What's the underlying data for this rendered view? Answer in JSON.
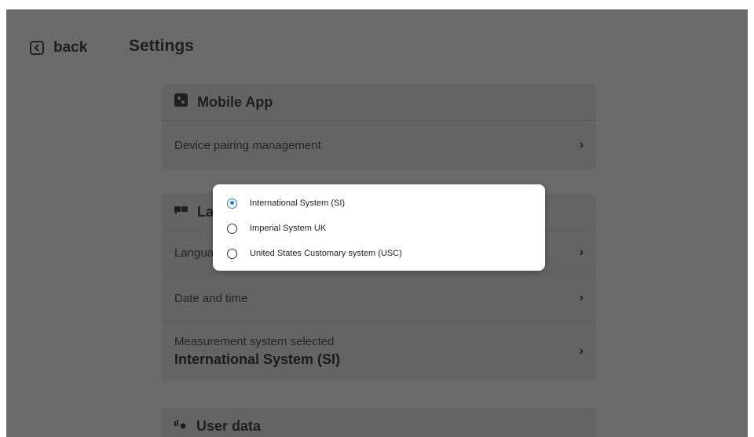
{
  "header": {
    "back_label": "back",
    "title": "Settings"
  },
  "mobile_app": {
    "title": "Mobile App",
    "icon": "mobile-app-icon",
    "rows": [
      {
        "label": "Device pairing management"
      }
    ]
  },
  "language_card": {
    "title_partial": "La",
    "icon": "language-icon",
    "rows": [
      {
        "label": "Langua"
      },
      {
        "label": "Date and time"
      }
    ],
    "measurement": {
      "label": "Measurement system selected",
      "value": "International System (SI)"
    }
  },
  "user_data": {
    "title": "User data",
    "icon": "user-data-icon"
  },
  "dialog": {
    "options": [
      {
        "label": "International System (SI)",
        "selected": true
      },
      {
        "label": "Imperial System UK",
        "selected": false
      },
      {
        "label": "United States Customary system (USC)",
        "selected": false
      }
    ]
  },
  "colors": {
    "accent": "#2a7fd4",
    "overlay": "#6b6b6b"
  }
}
